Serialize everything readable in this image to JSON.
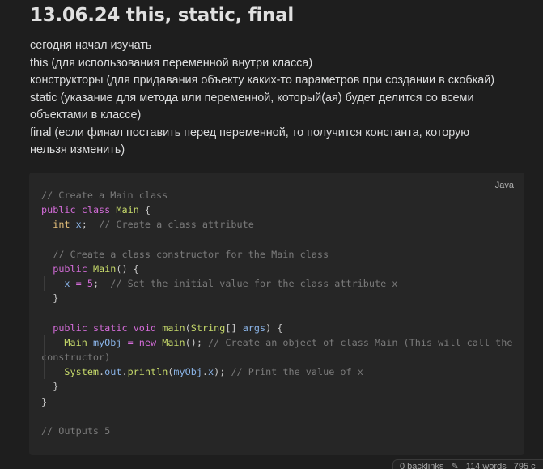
{
  "note": {
    "title": "13.06.24 this, static, final",
    "paragraph": [
      "сегодня начал изучать",
      "this (для использования переменной внутри класса)",
      "конструкторы (для придавания объекту каких-то параметров при создании в скобкай)",
      "static (указание для метода или переменной, который(ая) будет делится со всеми",
      "объектами в классе)",
      "final (если финал поставить перед переменной, то получится константа, которую",
      "нельзя изменить)"
    ]
  },
  "code_block": {
    "language": "Java",
    "lines": [
      "// Create a Main class",
      "public class Main {",
      "  int x;  // Create a class attribute",
      "",
      "  // Create a class constructor for the Main class",
      "  public Main() {",
      "    x = 5;  // Set the initial value for the class attribute x",
      "  }",
      "",
      "  public static void main(String[] args) {",
      "    Main myObj = new Main(); // Create an object of class Main (This will call the constructor)",
      "    System.out.println(myObj.x); // Print the value of x",
      "  }",
      "}",
      "",
      "// Outputs 5"
    ]
  },
  "status_bar": {
    "backlinks": "0 backlinks",
    "edit_icon": "pencil-icon",
    "words": "114 words",
    "characters": "795 c"
  },
  "colors": {
    "background": "#1e1e1e",
    "code_background": "#262626",
    "keyword": "#d46cd9",
    "type": "#e5c07b",
    "function": "#c6d96a",
    "comment": "#7a7a7a"
  }
}
